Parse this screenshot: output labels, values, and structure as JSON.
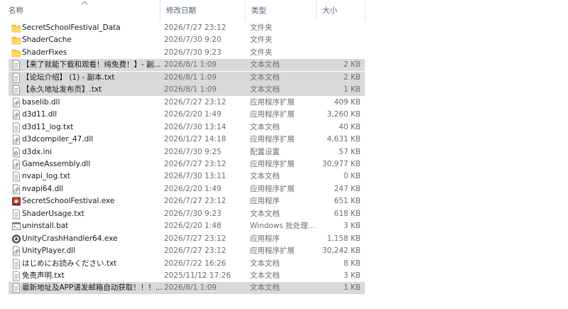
{
  "header": {
    "name": "名称",
    "date": "修改日期",
    "type": "类型",
    "size": "大小"
  },
  "rows": [
    {
      "name": "SecretSchoolFestival_Data",
      "date": "2026/7/27 23:12",
      "type": "文件夹",
      "size": "",
      "icon": "folder-icon",
      "selected": false
    },
    {
      "name": "ShaderCache",
      "date": "2026/7/30 9:20",
      "type": "文件夹",
      "size": "",
      "icon": "folder-icon",
      "selected": false
    },
    {
      "name": "ShaderFixes",
      "date": "2026/7/30 9:23",
      "type": "文件夹",
      "size": "",
      "icon": "folder-icon",
      "selected": false
    },
    {
      "name": "【来了就能下载和观看！纯免费！】- 副...",
      "date": "2026/8/1 1:09",
      "type": "文本文档",
      "size": "2 KB",
      "icon": "text-file-icon",
      "selected": true
    },
    {
      "name": "【论坛介绍】 (1) - 副本.txt",
      "date": "2026/8/1 1:09",
      "type": "文本文档",
      "size": "2 KB",
      "icon": "text-file-icon",
      "selected": true
    },
    {
      "name": "【永久地址发布页】.txt",
      "date": "2026/8/1 1:09",
      "type": "文本文档",
      "size": "1 KB",
      "icon": "text-file-icon",
      "selected": true
    },
    {
      "name": "baselib.dll",
      "date": "2026/7/27 23:12",
      "type": "应用程序扩展",
      "size": "409 KB",
      "icon": "dll-file-icon",
      "selected": false
    },
    {
      "name": "d3d11.dll",
      "date": "2026/2/20 1:49",
      "type": "应用程序扩展",
      "size": "3,260 KB",
      "icon": "dll-file-icon",
      "selected": false
    },
    {
      "name": "d3d11_log.txt",
      "date": "2026/7/30 13:14",
      "type": "文本文档",
      "size": "40 KB",
      "icon": "text-file-icon",
      "selected": false
    },
    {
      "name": "d3dcompiler_47.dll",
      "date": "2026/1/27 14:18",
      "type": "应用程序扩展",
      "size": "4,631 KB",
      "icon": "dll-file-icon",
      "selected": false
    },
    {
      "name": "d3dx.ini",
      "date": "2026/7/30 9:25",
      "type": "配置设置",
      "size": "57 KB",
      "icon": "ini-file-icon",
      "selected": false
    },
    {
      "name": "GameAssembly.dll",
      "date": "2026/7/27 23:12",
      "type": "应用程序扩展",
      "size": "30,977 KB",
      "icon": "dll-file-icon",
      "selected": false
    },
    {
      "name": "nvapi_log.txt",
      "date": "2026/7/30 13:11",
      "type": "文本文档",
      "size": "0 KB",
      "icon": "text-file-icon",
      "selected": false
    },
    {
      "name": "nvapi64.dll",
      "date": "2026/2/20 1:49",
      "type": "应用程序扩展",
      "size": "247 KB",
      "icon": "dll-file-icon",
      "selected": false
    },
    {
      "name": "SecretSchoolFestival.exe",
      "date": "2026/7/27 23:12",
      "type": "应用程序",
      "size": "651 KB",
      "icon": "game-exe-icon",
      "selected": false
    },
    {
      "name": "ShaderUsage.txt",
      "date": "2026/7/30 9:23",
      "type": "文本文档",
      "size": "618 KB",
      "icon": "text-file-icon",
      "selected": false
    },
    {
      "name": "uninstall.bat",
      "date": "2026/2/20 1:48",
      "type": "Windows 批处理...",
      "size": "3 KB",
      "icon": "bat-file-icon",
      "selected": false
    },
    {
      "name": "UnityCrashHandler64.exe",
      "date": "2026/7/27 23:12",
      "type": "应用程序",
      "size": "1,158 KB",
      "icon": "unity-exe-icon",
      "selected": false
    },
    {
      "name": "UnityPlayer.dll",
      "date": "2026/7/27 23:12",
      "type": "应用程序扩展",
      "size": "30,242 KB",
      "icon": "dll-file-icon",
      "selected": false
    },
    {
      "name": "はじめにお読みください.txt",
      "date": "2026/7/22 16:26",
      "type": "文本文档",
      "size": "8 KB",
      "icon": "text-file-icon",
      "selected": false
    },
    {
      "name": "免责声明.txt",
      "date": "2025/11/12 17:26",
      "type": "文本文档",
      "size": "3 KB",
      "icon": "text-file-icon",
      "selected": false
    },
    {
      "name": "最新地址及APP请发邮箱自动获取！！！...",
      "date": "2026/8/1 1:09",
      "type": "文本文档",
      "size": "1 KB",
      "icon": "text-file-icon",
      "selected": true
    }
  ]
}
